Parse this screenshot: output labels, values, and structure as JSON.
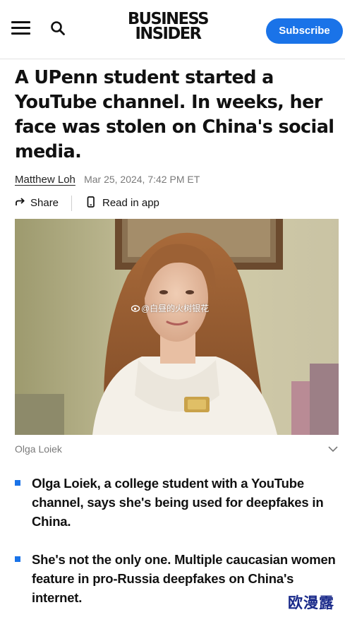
{
  "header": {
    "logo_line1": "BUSINESS",
    "logo_line2": "INSIDER",
    "subscribe_label": "Subscribe"
  },
  "article": {
    "headline": "A UPenn student started a YouTube channel. In weeks, her face was stolen on China's social media.",
    "author": "Matthew Loh",
    "date": "Mar 25, 2024, 7:42 PM ET",
    "share_label": "Share",
    "read_in_app_label": "Read in app",
    "image_watermark": "@白昼的火树银花",
    "caption": "Olga Loiek",
    "bullets": [
      "Olga Loiek, a college student with a YouTube channel, says she's being used for deepfakes in China.",
      "She's not the only one. Multiple caucasian women feature in pro-Russia deepfakes on China's internet."
    ]
  },
  "site_watermark": "欧漫露",
  "colors": {
    "accent": "#1a73e8",
    "text": "#111111",
    "muted": "#7a7a7a"
  },
  "icons": [
    "menu-icon",
    "search-icon",
    "share-arrow-icon",
    "phone-icon",
    "chevron-down-icon",
    "weibo-icon"
  ]
}
